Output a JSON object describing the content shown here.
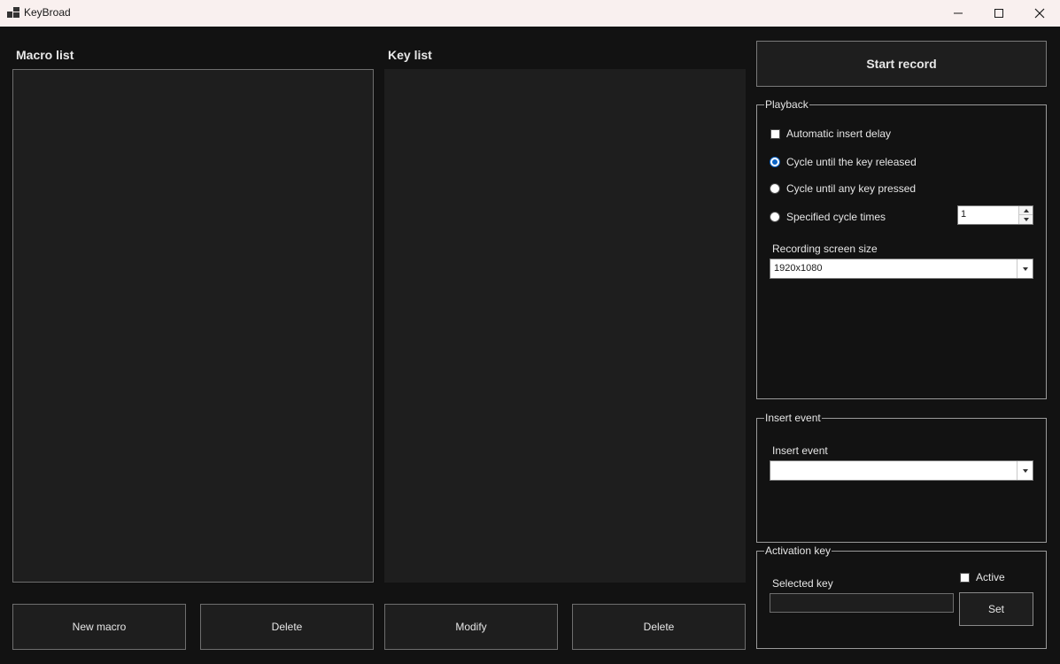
{
  "window": {
    "title": "KeyBroad"
  },
  "macro_list": {
    "label": "Macro list",
    "new_button": "New macro",
    "delete_button": "Delete"
  },
  "key_list": {
    "label": "Key list",
    "modify_button": "Modify",
    "delete_button": "Delete"
  },
  "record": {
    "start_button": "Start record"
  },
  "playback": {
    "title": "Playback",
    "auto_delay_label": "Automatic insert delay",
    "auto_delay_checked": false,
    "options": [
      {
        "label": "Cycle until the key released",
        "checked": true
      },
      {
        "label": "Cycle until any key pressed",
        "checked": false
      },
      {
        "label": "Specified cycle times",
        "checked": false
      }
    ],
    "cycle_times_value": "1",
    "screen_size_label": "Recording screen size",
    "screen_size_value": "1920x1080"
  },
  "insert_event": {
    "title": "Insert event",
    "label": "Insert event",
    "value": ""
  },
  "activation": {
    "title": "Activation key",
    "selected_key_label": "Selected key",
    "selected_key_value": "",
    "active_label": "Active",
    "active_checked": false,
    "set_button": "Set"
  }
}
